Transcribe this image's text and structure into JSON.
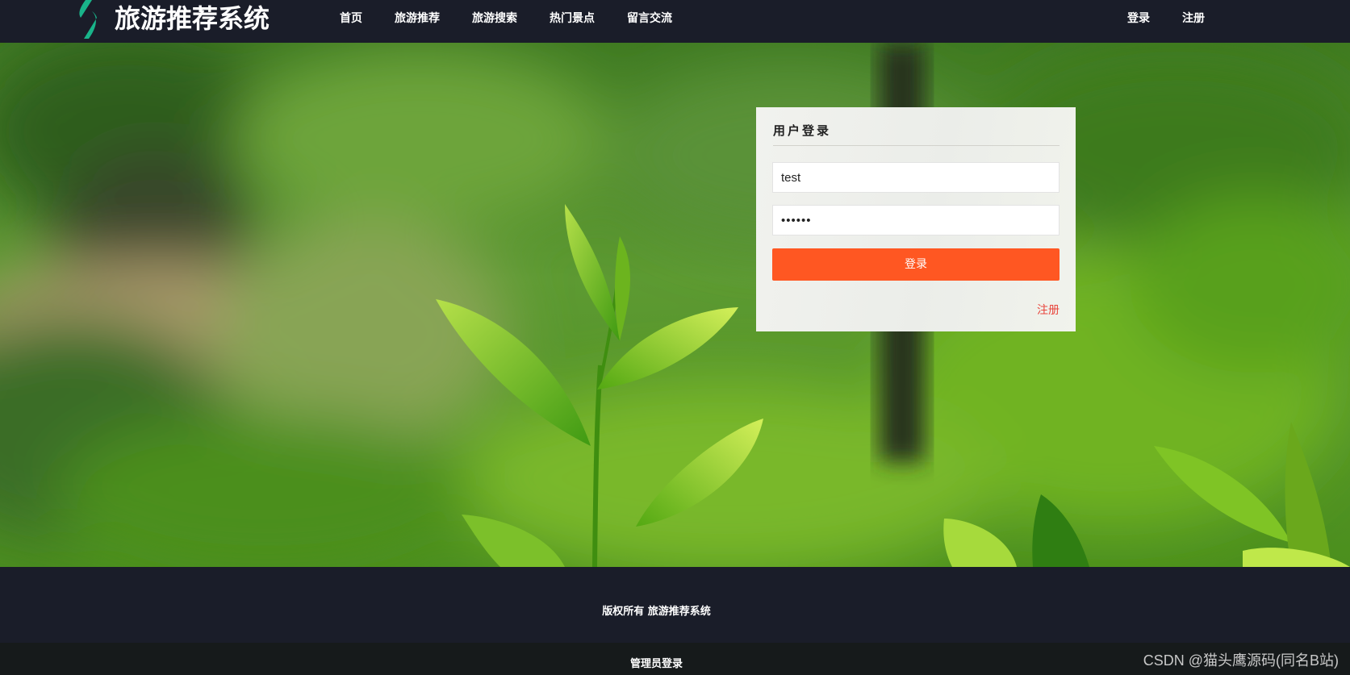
{
  "header": {
    "site_title": "旅游推荐系统",
    "nav": [
      "首页",
      "旅游推荐",
      "旅游搜索",
      "热门景点",
      "留言交流"
    ],
    "auth": {
      "login": "登录",
      "register": "注册"
    }
  },
  "login_form": {
    "title": "用户登录",
    "username_value": "test",
    "password_value": "123456",
    "submit_label": "登录",
    "register_link": "注册"
  },
  "footer": {
    "copyright": "版权所有 旅游推荐系统",
    "admin_login": "管理员登录"
  },
  "watermark": "CSDN @猫头鹰源码(同名B站)",
  "colors": {
    "nav_bg": "#1a1d29",
    "accent_button": "#ff5722",
    "register_link": "#e8453c",
    "logo_green": "#19b48a"
  },
  "icons": {
    "logo": "leaf-logo-icon"
  }
}
